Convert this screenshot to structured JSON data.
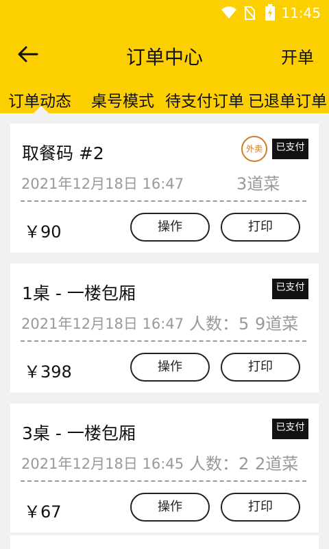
{
  "status_bar": {
    "time": "11:45"
  },
  "header": {
    "title": "订单中心",
    "action": "开单"
  },
  "tabs": [
    "订单动态",
    "桌号模式",
    "待支付订单",
    "已退单订单"
  ],
  "orders": [
    {
      "name": "取餐码 #2",
      "datetime": "2021年12月18日 16:47",
      "people": "",
      "dishes": "3道菜",
      "price": "￥90",
      "paid_label": "已支付",
      "takeout_label": "外卖",
      "op_label": "操作",
      "print_label": "打印"
    },
    {
      "name": "1桌 - 一楼包厢",
      "datetime": "2021年12月18日 16:47",
      "people": "人数：5",
      "dishes": "9道菜",
      "price": "￥398",
      "paid_label": "已支付",
      "op_label": "操作",
      "print_label": "打印"
    },
    {
      "name": "3桌 - 一楼包厢",
      "datetime": "2021年12月18日 16:45",
      "people": "人数：2",
      "dishes": "2道菜",
      "price": "￥67",
      "paid_label": "已支付",
      "op_label": "操作",
      "print_label": "打印"
    }
  ]
}
